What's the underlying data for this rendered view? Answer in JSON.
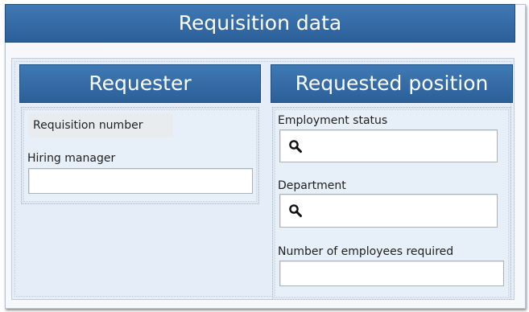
{
  "form": {
    "title": "Requisition data",
    "requester": {
      "header": "Requester",
      "requisition_number_label": "Requisition number",
      "hiring_manager_label": "Hiring manager",
      "hiring_manager_value": ""
    },
    "requested_position": {
      "header": "Requested position",
      "employment_status_label": "Employment status",
      "employment_status_value": "",
      "department_label": "Department",
      "department_value": "",
      "employees_required_label": "Number of employees required",
      "employees_required_value": ""
    }
  },
  "colors": {
    "header_blue": "#2f65a0",
    "panel_background": "#e5eef8"
  },
  "icons": {
    "lookup": "search-icon"
  }
}
